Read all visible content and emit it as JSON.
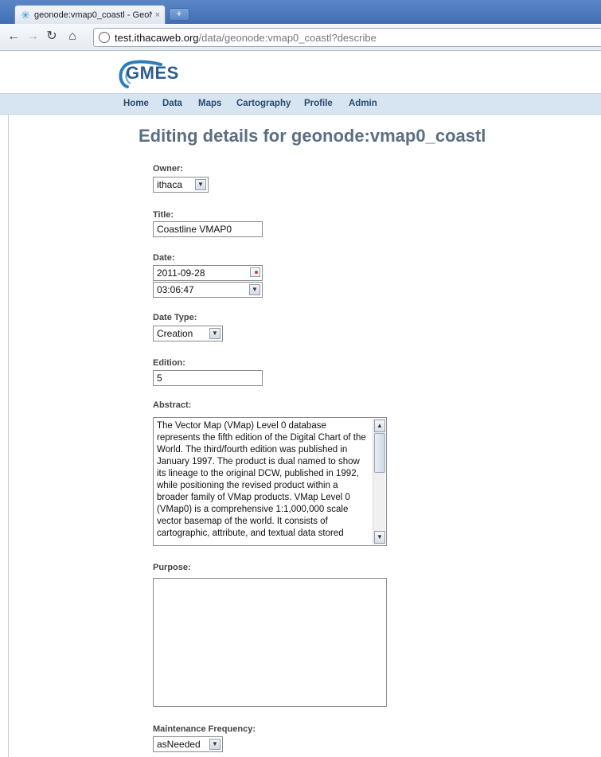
{
  "browser": {
    "tab_title": "geonode:vmap0_coastl - GeoN",
    "tab_close": "×",
    "new_tab": "+",
    "url_host": "test.ithacaweb.org",
    "url_path": "/data/geonode:vmap0_coastl?describe"
  },
  "site": {
    "logo_text": "GMES",
    "nav": [
      "Home",
      "Data",
      "Maps",
      "Cartography",
      "Profile",
      "Admin"
    ]
  },
  "page": {
    "heading": "Editing details for geonode:vmap0_coastl"
  },
  "form": {
    "owner": {
      "label": "Owner:",
      "value": "ithaca"
    },
    "title": {
      "label": "Title:",
      "value": "Coastline VMAP0"
    },
    "date": {
      "label": "Date:",
      "date_value": "2011-09-28",
      "time_value": "03:06:47"
    },
    "date_type": {
      "label": "Date Type:",
      "value": "Creation"
    },
    "edition": {
      "label": "Edition:",
      "value": "5"
    },
    "abstract": {
      "label": "Abstract:",
      "value": "The Vector Map (VMap) Level 0 database represents the fifth edition of the Digital Chart of the World. The third/fourth edition was published in January 1997. The product is dual named to show its lineage to the original DCW, published in 1992, while positioning the revised product within a broader family of VMap products. VMap Level 0 (VMap0) is a comprehensive 1:1,000,000 scale vector basemap of the world. It consists of cartographic, attribute, and textual data stored"
    },
    "purpose": {
      "label": "Purpose:",
      "value": ""
    },
    "maintenance_frequency": {
      "label": "Maintenance Frequency:",
      "value": "asNeeded"
    }
  }
}
